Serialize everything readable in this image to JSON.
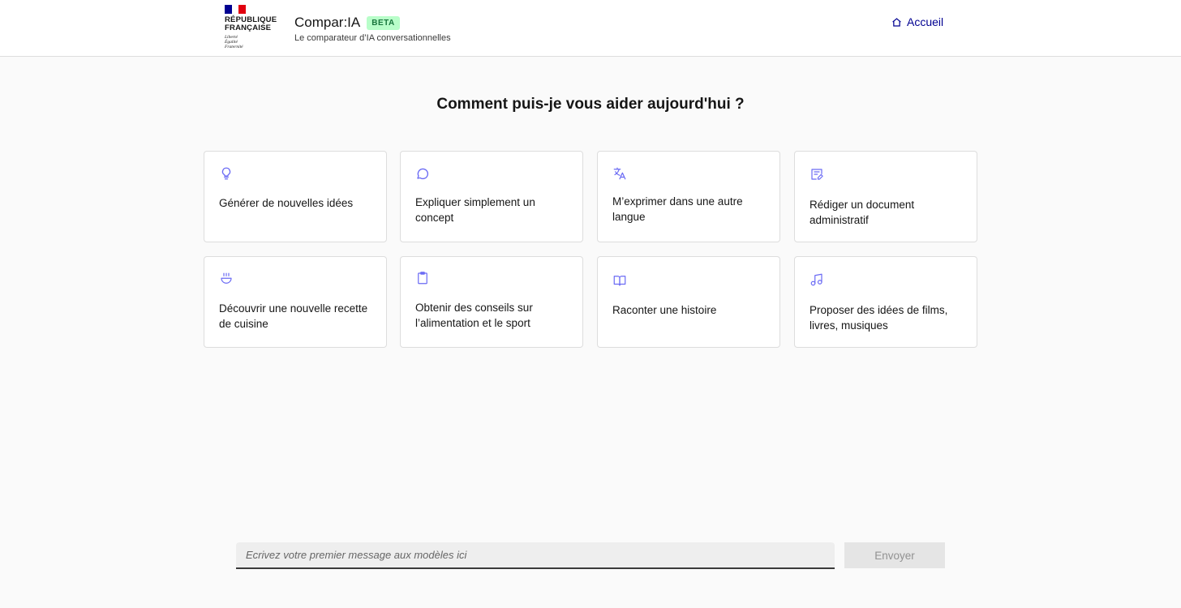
{
  "header": {
    "gov_name_lines": [
      "RÉPUBLIQUE",
      "FRANÇAISE"
    ],
    "gov_motto_lines": [
      "Liberté",
      "Égalité",
      "Fraternité"
    ],
    "brand_title": "Compar:IA",
    "badge": "BETA",
    "subtitle": "Le comparateur d’IA conversationnelles",
    "home_link": "Accueil",
    "home_icon": "home-icon",
    "flag_colors": [
      "#000091",
      "#ffffff",
      "#e1000f"
    ]
  },
  "main": {
    "title": "Comment puis-je vous aider aujourd'hui ?",
    "accent_color": "#6a6af4",
    "cards": [
      {
        "label": "Générer de nouvelles idées",
        "icon": "lightbulb-icon"
      },
      {
        "label": "Expliquer simplement un concept",
        "icon": "chat-bubble-icon"
      },
      {
        "label": "M’exprimer dans une autre langue",
        "icon": "translate-icon"
      },
      {
        "label": "Rédiger un document administratif",
        "icon": "edit-document-icon"
      },
      {
        "label": "Découvrir une nouvelle recette de cuisine",
        "icon": "bowl-icon"
      },
      {
        "label": "Obtenir des conseils sur l’alimentation et le sport",
        "icon": "clipboard-icon"
      },
      {
        "label": "Raconter une histoire",
        "icon": "book-icon"
      },
      {
        "label": "Proposer des idées de films, livres, musiques",
        "icon": "music-note-icon"
      }
    ]
  },
  "composer": {
    "placeholder": "Ecrivez votre premier message aux modèles ici",
    "value": "",
    "send_label": "Envoyer"
  }
}
